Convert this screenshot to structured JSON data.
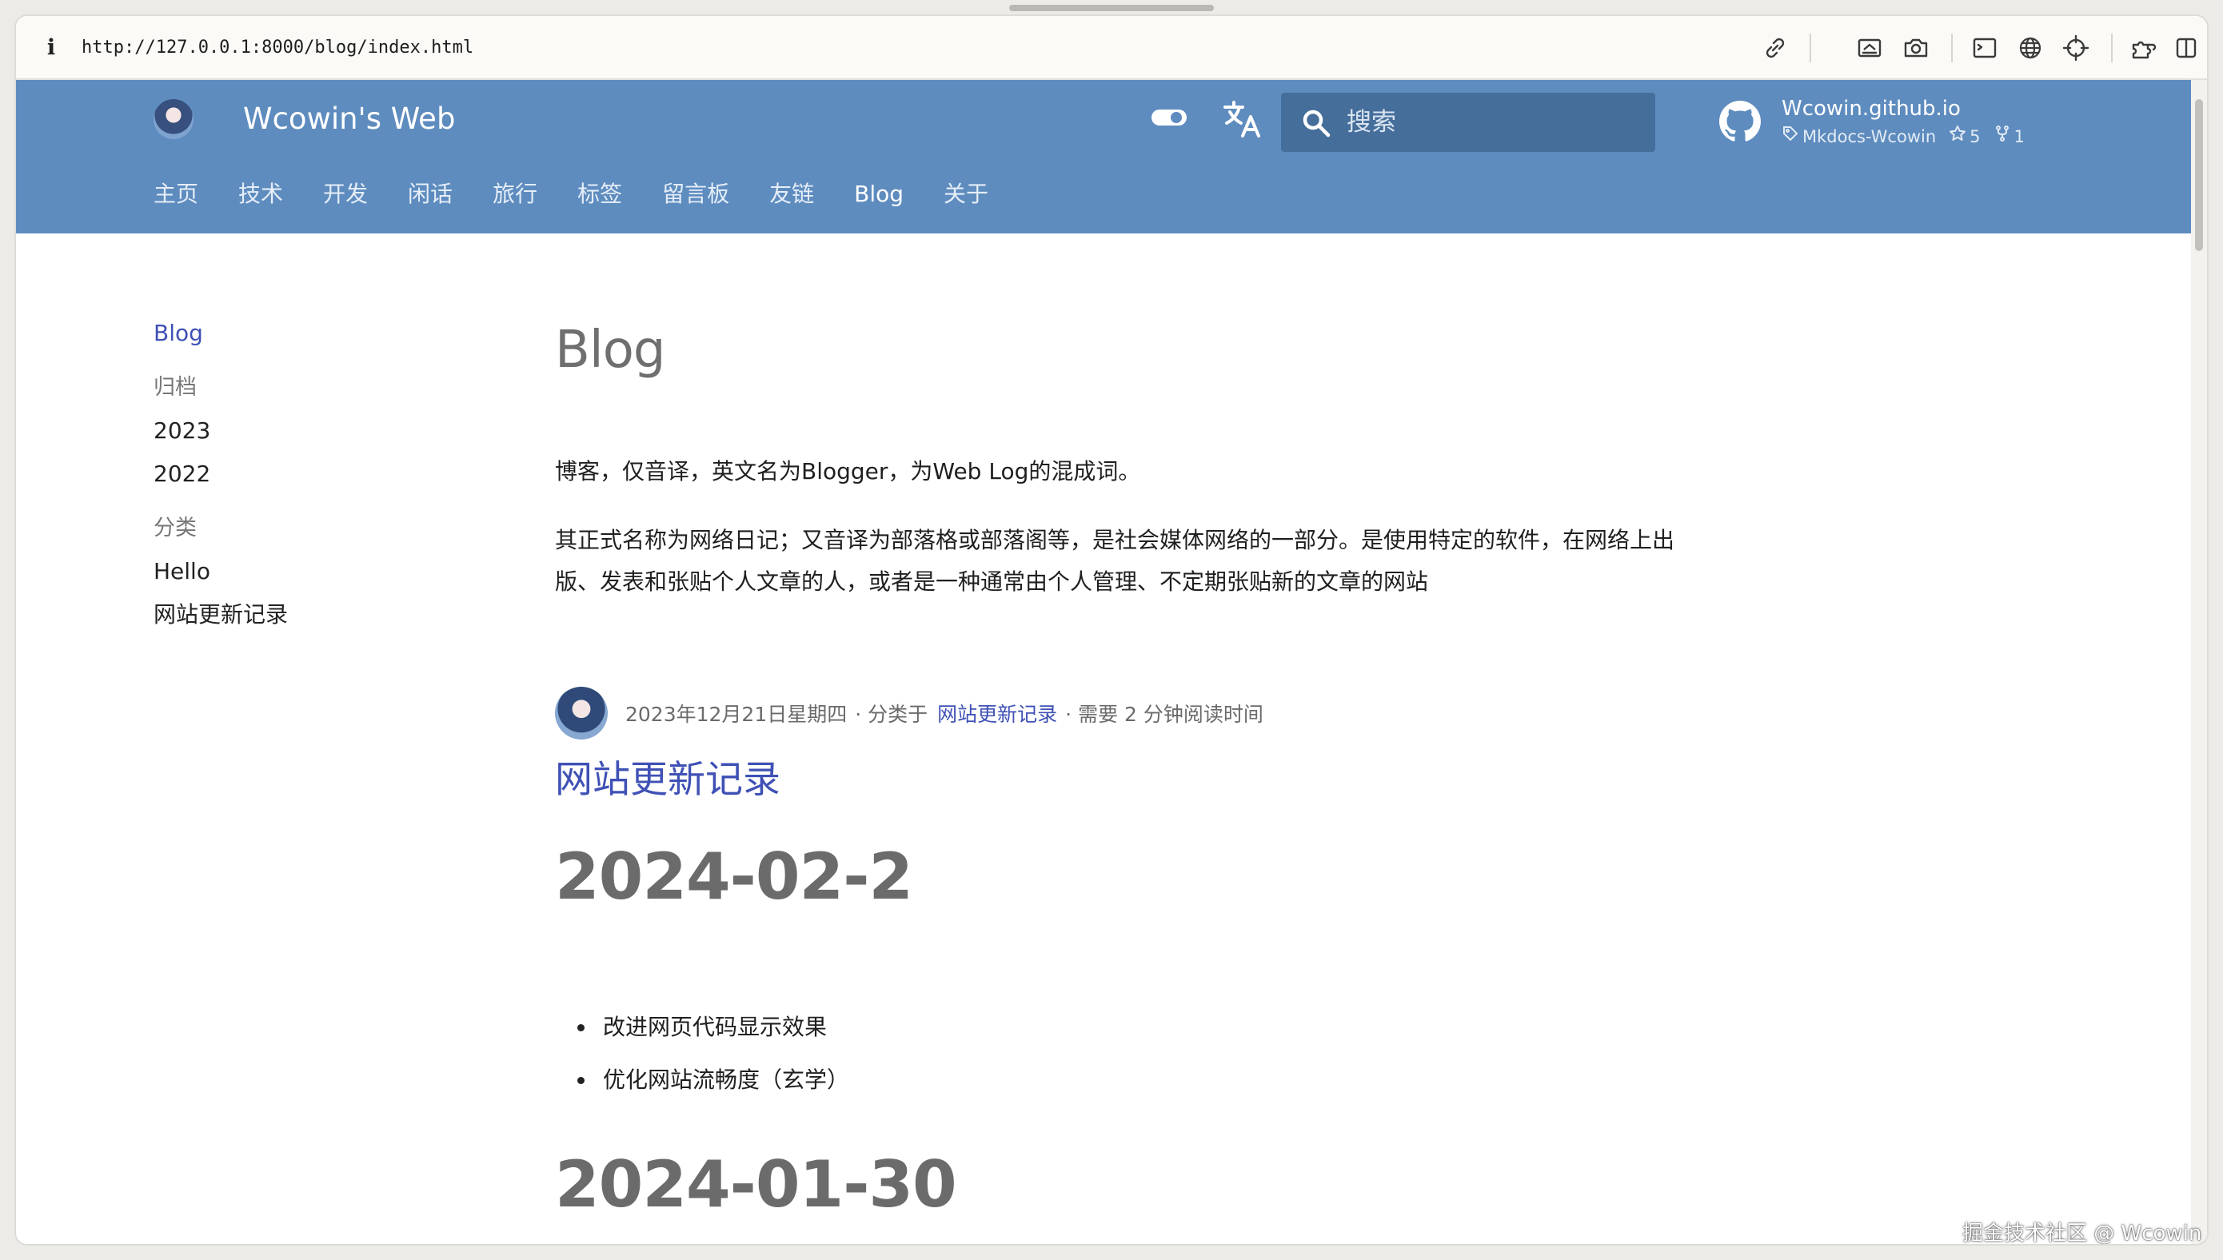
{
  "browser": {
    "url": "http://127.0.0.1:8000/blog/index.html"
  },
  "header": {
    "site_title": "Wcowin's Web",
    "search_placeholder": "搜索",
    "repo": {
      "name": "Wcowin.github.io",
      "tag": "Mkdocs-Wcowin",
      "stars": "5",
      "forks": "1"
    },
    "tabs": [
      {
        "label": "主页"
      },
      {
        "label": "技术"
      },
      {
        "label": "开发"
      },
      {
        "label": "闲话"
      },
      {
        "label": "旅行"
      },
      {
        "label": "标签"
      },
      {
        "label": "留言板"
      },
      {
        "label": "友链"
      },
      {
        "label": "Blog",
        "active": true
      },
      {
        "label": "关于"
      }
    ]
  },
  "sidebar": {
    "current": "Blog",
    "archive_heading": "归档",
    "archive": [
      "2023",
      "2022"
    ],
    "category_heading": "分类",
    "categories": [
      "Hello",
      "网站更新记录"
    ]
  },
  "main": {
    "title": "Blog",
    "intro_1": "博客，仅音译，英文名为Blogger，为Web Log的混成词。",
    "intro_2": "其正式名称为网络日记；又音译为部落格或部落阁等，是社会媒体网络的一部分。是使用特定的软件，在网络上出版、发表和张贴个人文章的人，或者是一种通常由个人管理、不定期张贴新的文章的网站",
    "post": {
      "date": "2023年12月21日星期四",
      "category_prefix": "· 分类于",
      "category": "网站更新记录",
      "read_time": "· 需要 2 分钟阅读时间",
      "title": "网站更新记录",
      "section_1": "2024-02-2",
      "items": [
        "改进网页代码显示效果",
        "优化网站流畅度（玄学）"
      ],
      "section_2": "2024-01-30"
    }
  },
  "watermark": "掘金技术社区 @ Wcowin",
  "colors": {
    "header_bg": "#5e8cbf",
    "search_bg": "#466e9b",
    "link": "#3f51b5"
  },
  "icons": [
    "info-icon",
    "link-icon",
    "screenshot-icon",
    "camera-icon",
    "terminal-icon",
    "globe-icon",
    "crosshair-icon",
    "extensions-icon",
    "sidebar-icon",
    "theme-toggle-icon",
    "translate-icon",
    "search-icon",
    "github-icon",
    "tag-icon",
    "star-icon",
    "fork-icon"
  ]
}
